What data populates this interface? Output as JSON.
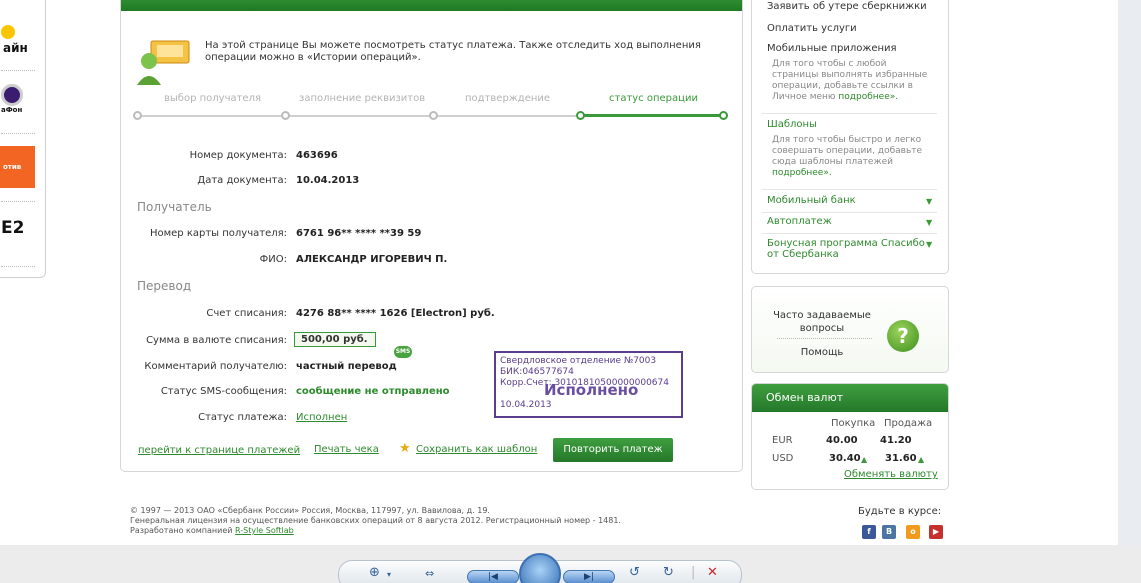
{
  "left_providers": [
    "айн",
    "аФон",
    "отив",
    "E2"
  ],
  "intro_text": "На этой странице Вы можете посмотреть статус платежа. Также отследить ход выполнения операции можно в «Истории операций».",
  "steps": [
    {
      "label": "выбор получателя",
      "active": false
    },
    {
      "label": "заполнение реквизитов",
      "active": false
    },
    {
      "label": "подтверждение",
      "active": false
    },
    {
      "label": "статус операции",
      "active": true
    }
  ],
  "document": {
    "number_label": "Номер документа:",
    "number": "463696",
    "date_label": "Дата документа:",
    "date": "10.04.2013"
  },
  "recipient": {
    "section": "Получатель",
    "card_label": "Номер карты получателя:",
    "card": "6761 96** **** **39 59",
    "name_label": "ФИО:",
    "name": "АЛЕКСАНДР ИГОРЕВИЧ П."
  },
  "transfer": {
    "section": "Перевод",
    "account_label": "Счет списания:",
    "account": "4276 88** **** 1626  [Electron]  руб.",
    "amount_label": "Сумма в валюте списания:",
    "amount": "500,00  руб.",
    "comment_label": "Комментарий получателю:",
    "comment": "частный перевод",
    "sms_badge": "SMS",
    "sms_status_label": "Статус SMS-сообщения:",
    "sms_status": "сообщение не отправлено",
    "status_label": "Статус платежа:",
    "status": "Исполнен"
  },
  "stamp": {
    "line1": "Свердловское отделение №7003",
    "line2": "БИК:046577674",
    "line3": "Корр.Счет: 30101810500000000674",
    "big": "Исполнено",
    "date": "10.04.2013"
  },
  "actions": {
    "to_payments": "перейти к странице платежей",
    "print": "Печать чека",
    "save_template": "Сохранить как шаблон",
    "repeat": "Повторить платеж"
  },
  "sidebar": {
    "lost_book": "Заявить об утере сберкнижки",
    "pay_services": "Оплатить услуги",
    "mobile_apps": "Мобильные приложения",
    "mobile_apps_desc": "Для того чтобы с любой страницы выполнять избранные операции, добавьте ссылки в Личное меню",
    "more1": "подробнее».",
    "templates": "Шаблоны",
    "templates_desc": "Для того чтобы быстро и легко совершать операции, добавьте сюда шаблоны платежей",
    "more2": "подробнее».",
    "mobile_bank": "Мобильный банк",
    "autopay": "Автоплатеж",
    "bonus1": "Бонусная программа Спасибо",
    "bonus2": "от Сбербанка"
  },
  "faq": {
    "title": "Часто задаваемые вопросы",
    "help": "Помощь"
  },
  "fx": {
    "title": "Обмен валют",
    "buy_header": "Покупка",
    "sell_header": "Продажа",
    "rows": [
      {
        "currency": "EUR",
        "buy": "40.00",
        "sell": "41.20",
        "buy_up": false,
        "sell_up": false
      },
      {
        "currency": "USD",
        "buy": "30.40",
        "sell": "31.60",
        "buy_up": true,
        "sell_up": true
      }
    ],
    "exchange_link": "Обменять валюту"
  },
  "footer": {
    "line1": "© 1997 — 2013 ОАО «Сбербанк России» Россия, Москва, 117997, ул. Вавилова, д. 19.",
    "line2": "Генеральная лицензия на осуществление банковских операций от 8 августа 2012. Регистрационный номер - 1481.",
    "line3_prefix": "Разработано компанией ",
    "line3_link": "R-Style Softlab"
  },
  "social": {
    "title": "Будьте в курсе:",
    "icons": [
      "facebook-icon",
      "vk-icon",
      "odnoklassniki-icon",
      "youtube-icon"
    ],
    "colors": [
      "#3b5998",
      "#4c75a3",
      "#f29a1b",
      "#c4302b"
    ]
  },
  "accent": "#3a9a3a"
}
